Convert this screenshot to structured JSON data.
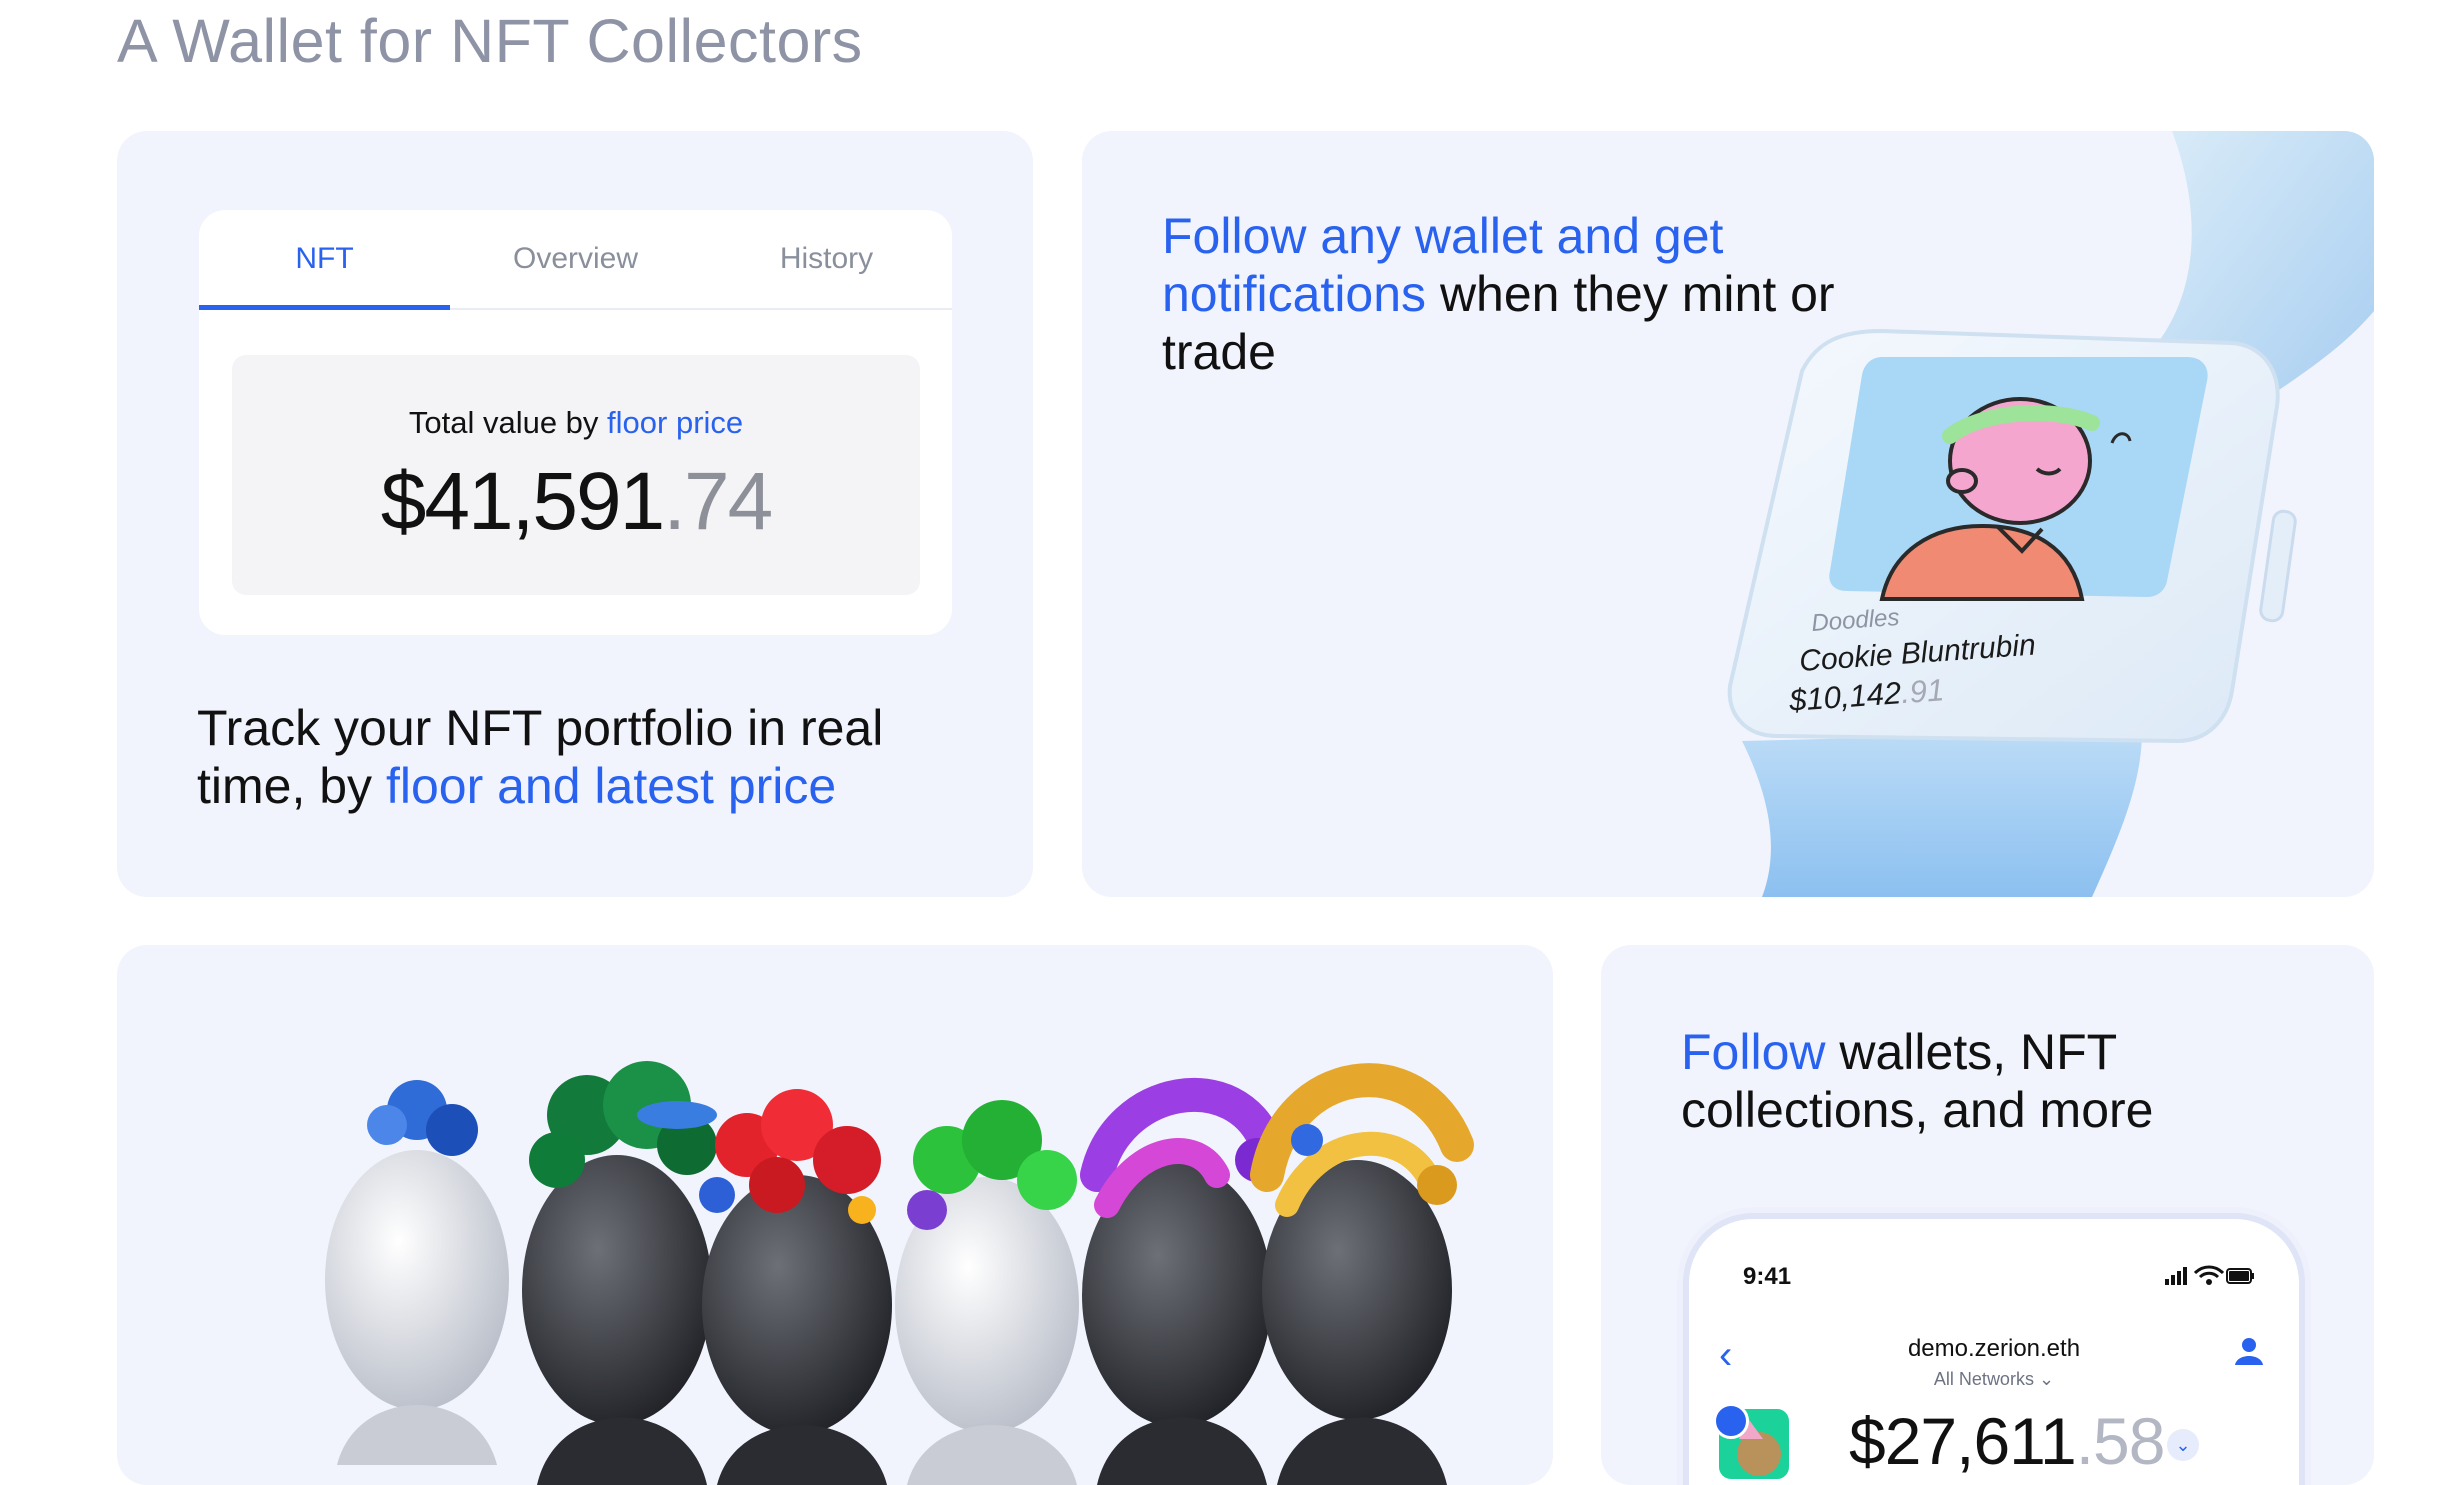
{
  "section": {
    "title": "A Wallet for NFT Collectors"
  },
  "card1": {
    "tabs": [
      {
        "label": "NFT",
        "active": true
      },
      {
        "label": "Overview",
        "active": false
      },
      {
        "label": "History",
        "active": false
      }
    ],
    "value_label_prefix": "Total value by ",
    "value_label_link": "floor price",
    "value_whole": "$41,591",
    "value_cents": ".74",
    "text_plain": "Track your NFT portfolio in real time, by ",
    "text_highlight": "floor and latest price"
  },
  "card2": {
    "text_highlight": "Follow any wallet and get notifications",
    "text_plain": " when they mint or trade",
    "watch": {
      "collection": "Doodles",
      "name": "Cookie Bluntrubin",
      "price_whole": "$10,142",
      "price_cents": ".91"
    }
  },
  "card4": {
    "text_highlight": "Follow",
    "text_plain": " wallets, NFT collections, and more",
    "phone": {
      "time": "9:41",
      "address": "demo.zerion.eth",
      "network": "All Networks",
      "balance_whole": "$27,611",
      "balance_cents": ".58"
    }
  },
  "colors": {
    "accent": "#2962ef",
    "card_bg": "#f1f4fc",
    "title_gray": "#8e93a6"
  },
  "icons": [
    "back-chevron-icon",
    "user-icon",
    "signal-icon",
    "wifi-icon",
    "battery-icon",
    "chevron-down-icon"
  ]
}
